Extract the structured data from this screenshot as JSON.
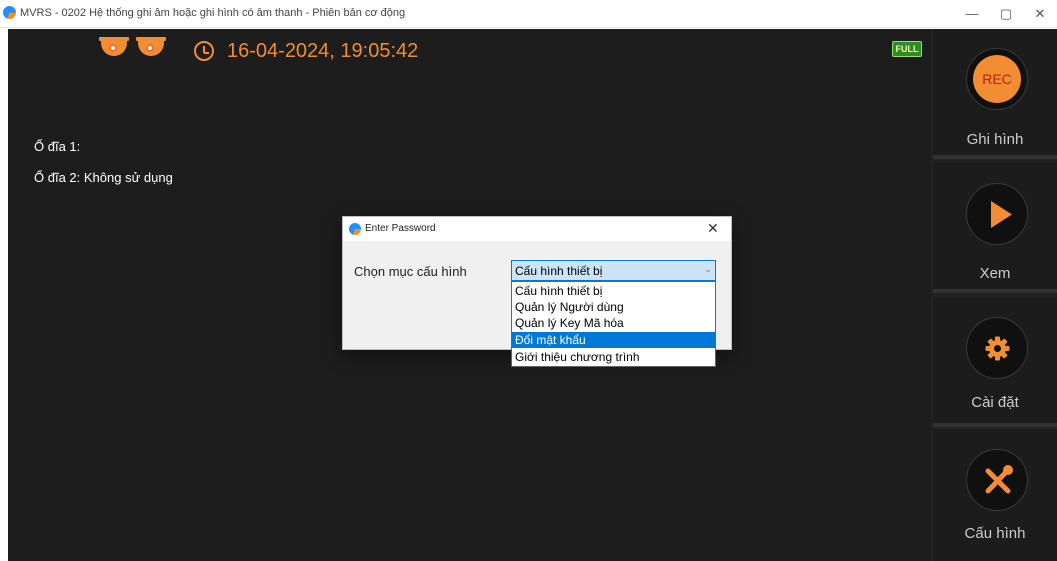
{
  "window": {
    "title": "MVRS - 0202 Hệ thống ghi âm hoặc ghi hình có âm thanh - Phiên bản cơ động",
    "minimize_glyph": "—",
    "maximize_glyph": "▢",
    "close_glyph": "✕"
  },
  "header": {
    "datetime": "16-04-2024, 19:05:42",
    "full_badge": "FULL",
    "icons": [
      "camera-icon",
      "camera-icon",
      "alarm-clock-icon",
      "full-storage-icon"
    ]
  },
  "drives": {
    "drive1": "Ổ đĩa 1:",
    "drive2": "Ổ đĩa 2: Không sử dụng"
  },
  "sidebar": {
    "items": [
      {
        "label": "Ghi hình",
        "icon": "rec-icon",
        "icon_text": "REC"
      },
      {
        "label": "Xem",
        "icon": "play-icon"
      },
      {
        "label": "Cài đặt",
        "icon": "gear-icon"
      },
      {
        "label": "Cấu hình",
        "icon": "tools-icon"
      }
    ]
  },
  "dialog": {
    "title": "Enter Password",
    "close_glyph": "✕",
    "field_label": "Chọn mục cấu hình",
    "selected_value": "Cấu hình thiết bị",
    "options": [
      "Cấu hình thiết bị",
      "Quản lý Người dùng",
      "Quản lý Key Mã hóa",
      "Đổi mật khẩu",
      "Giới thiệu chương trình"
    ],
    "highlighted_option": "Đổi mật khẩu"
  },
  "colors": {
    "accent_orange": "#f28d33",
    "background_dark": "#1d1d1d",
    "selection_blue": "#0078d7"
  }
}
